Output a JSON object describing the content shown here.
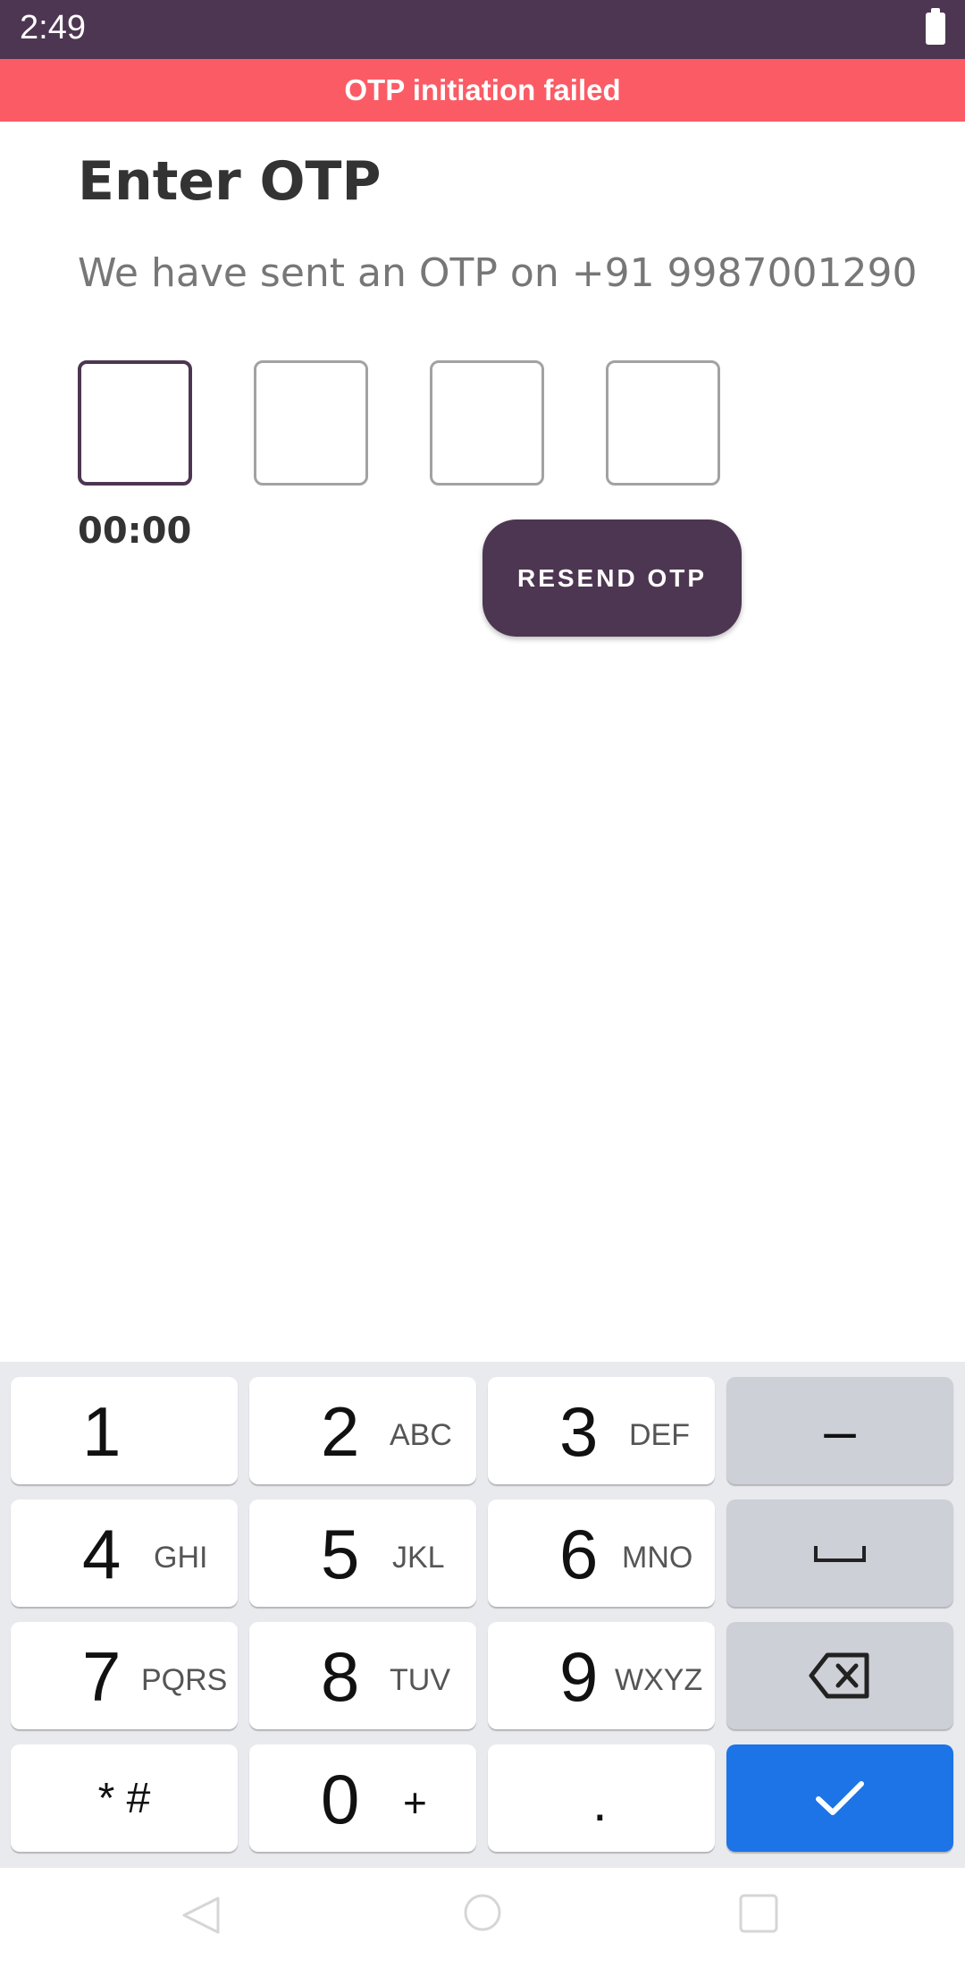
{
  "status_bar": {
    "time": "2:49"
  },
  "banner": {
    "text": "OTP initiation failed",
    "color": "#fb5b65"
  },
  "screen": {
    "title": "Enter OTP",
    "subtitle": "We have sent an OTP on +91 9987001290",
    "otp_boxes": [
      "",
      "",
      "",
      ""
    ],
    "timer": "00:00",
    "resend_label": "RESEND OTP"
  },
  "colors": {
    "primary": "#4d3651",
    "key_accent": "#1c74e7"
  },
  "keyboard": {
    "keys": [
      {
        "num": "1",
        "letters": ""
      },
      {
        "num": "2",
        "letters": "ABC"
      },
      {
        "num": "3",
        "letters": "DEF"
      },
      {
        "num": "4",
        "letters": "GHI"
      },
      {
        "num": "5",
        "letters": "JKL"
      },
      {
        "num": "6",
        "letters": "MNO"
      },
      {
        "num": "7",
        "letters": "PQRS"
      },
      {
        "num": "8",
        "letters": "TUV"
      },
      {
        "num": "9",
        "letters": "WXYZ"
      },
      {
        "num": "0",
        "letters": "+"
      }
    ],
    "minus": "–",
    "star_hash": "* #",
    "period": ".",
    "icons": [
      "space-icon",
      "backspace-icon",
      "checkmark-icon"
    ]
  },
  "nav_icons": [
    "back-icon",
    "home-icon",
    "recents-icon"
  ]
}
